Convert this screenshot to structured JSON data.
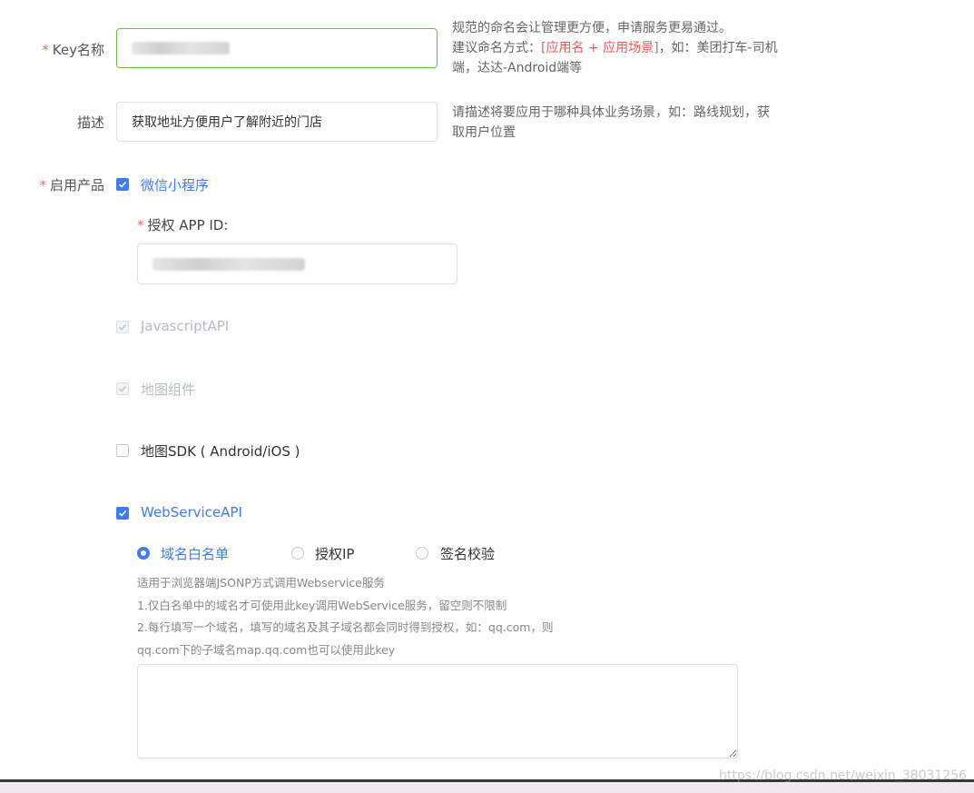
{
  "form": {
    "key_name": {
      "required_mark": "*",
      "label": "Key名称",
      "hint_line1": "规范的命名会让管理更方便，申请服务更易通过。",
      "hint_line2_prefix": "建议命名方式：",
      "hint_line2_red": "[应用名 + 应用场景]",
      "hint_line2_suffix": "，如：美团打车-司机",
      "hint_line3": "端，达达-Android端等"
    },
    "description": {
      "label": "描述",
      "value": "获取地址方便用户了解附近的门店",
      "hint_line1": "请描述将要应用于哪种具体业务场景，如：路线规划，获",
      "hint_line2": "取用户位置"
    },
    "products": {
      "required_mark": "*",
      "label": "启用产品",
      "wechat": {
        "label": "微信小程序",
        "checked": true
      },
      "app_id": {
        "required_mark": "*",
        "label": "授权 APP ID:"
      },
      "js_api": {
        "label": "JavascriptAPI",
        "checked": true,
        "disabled": true
      },
      "map_component": {
        "label": "地图组件",
        "checked": true,
        "disabled": true
      },
      "map_sdk": {
        "label": "地图SDK ( Android/iOS )",
        "checked": false
      },
      "webservice": {
        "label": "WebServiceAPI",
        "checked": true
      }
    },
    "webservice_options": {
      "radios": [
        {
          "label": "域名白名单",
          "checked": true
        },
        {
          "label": "授权IP",
          "checked": false
        },
        {
          "label": "签名校验",
          "checked": false
        }
      ],
      "help_lines": [
        "适用于浏览器端JSONP方式调用Webservice服务",
        "1.仅白名单中的域名才可使用此key调用WebService服务，留空则不限制",
        "2.每行填写一个域名，填写的域名及其子域名都会同时得到授权，如：qq.com，则",
        "qq.com下的子域名map.qq.com也可以使用此key"
      ]
    }
  },
  "watermark": "https://blog.csdn.net/weixin_38031256",
  "colors": {
    "accent": "#3f7cf0",
    "required": "#f56c6c",
    "focus_border": "#6cc04a"
  }
}
